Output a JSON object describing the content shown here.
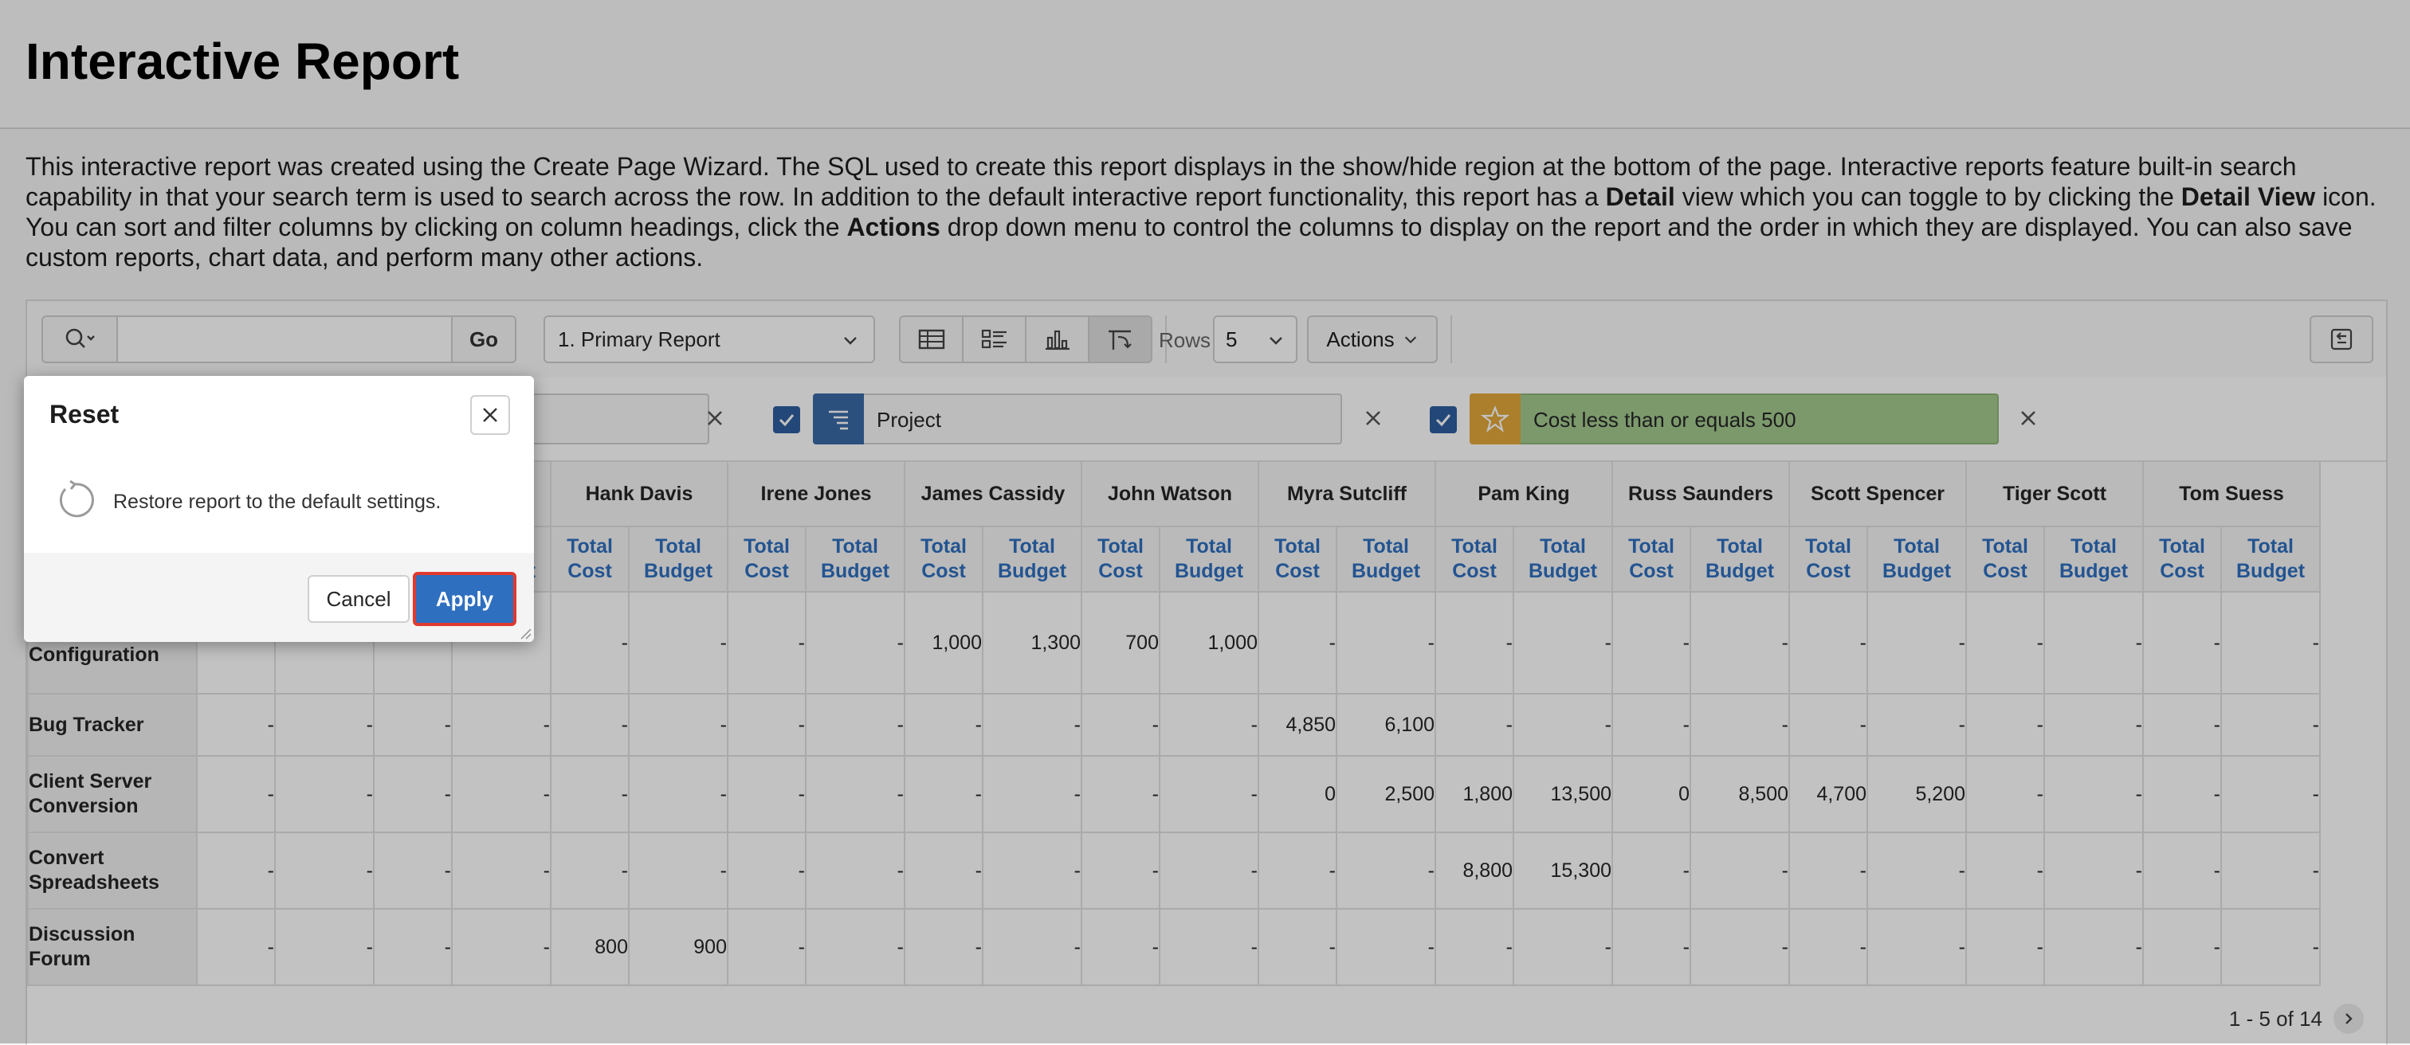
{
  "page": {
    "title": "Interactive Report",
    "description": [
      {
        "text": "This interactive report was created using the Create Page Wizard. The SQL used to create this report displays in the show/hide region at the bottom of the page. Interactive reports feature built-in search capability in that your search term is used to search across the row. In addition to the default interactive report functionality, this report has a ",
        "bold": false
      },
      {
        "text": "Detail",
        "bold": true
      },
      {
        "text": " view which you can toggle to by clicking the ",
        "bold": false
      },
      {
        "text": "Detail View",
        "bold": true
      },
      {
        "text": " icon. You can sort and filter columns by clicking on column headings, click the ",
        "bold": false
      },
      {
        "text": "Actions",
        "bold": true
      },
      {
        "text": " drop down menu to control the columns to display on the report and the order in which they are displayed. You can also save custom reports, chart data, and perform many other actions.",
        "bold": false
      }
    ]
  },
  "toolbar": {
    "search_icon": "search-icon",
    "search_value": "",
    "go_label": "Go",
    "report_select": "1. Primary Report",
    "views": [
      "grid-view-icon",
      "detail-view-icon",
      "chart-view-icon",
      "pivot-view-icon"
    ],
    "active_view": "pivot-view-icon",
    "rows_label": "Rows",
    "rows_value": "5",
    "actions_label": "Actions",
    "reset_icon": "reset-icon"
  },
  "filters": [
    {
      "checked": true,
      "icon": "pivot-icon",
      "label": "Project",
      "type": "pivot"
    },
    {
      "checked": true,
      "icon": "star-icon",
      "label": "Cost less than or equals 500",
      "type": "highlight",
      "color": "#a4c98f"
    }
  ],
  "table": {
    "pivot_columns": [
      "",
      "",
      "Hank Davis",
      "Irene Jones",
      "James Cassidy",
      "John Watson",
      "Myra Sutcliff",
      "Pam King",
      "Russ Saunders",
      "Scott Spencer",
      "Tiger Scott",
      "Tom Suess"
    ],
    "sub_columns": [
      "Total Cost",
      "Total Budget"
    ],
    "rows": [
      {
        "label": "Express Configuration",
        "values": [
          "",
          "",
          "",
          "",
          "-",
          "-",
          "-",
          "-",
          "1,000",
          "1,300",
          "700",
          "1,000",
          "-",
          "-",
          "-",
          "-",
          "-",
          "-",
          "-",
          "-",
          "-",
          "-",
          "-",
          "-"
        ]
      },
      {
        "label": "Bug Tracker",
        "values": [
          "-",
          "-",
          "-",
          "-",
          "-",
          "-",
          "-",
          "-",
          "-",
          "-",
          "-",
          "-",
          "4,850",
          "6,100",
          "-",
          "-",
          "-",
          "-",
          "-",
          "-",
          "-",
          "-",
          "-",
          "-"
        ]
      },
      {
        "label": "Client Server Conversion",
        "values": [
          "-",
          "-",
          "-",
          "-",
          "-",
          "-",
          "-",
          "-",
          "-",
          "-",
          "-",
          "-",
          "0",
          "2,500",
          "1,800",
          "13,500",
          "0",
          "8,500",
          "4,700",
          "5,200",
          "-",
          "-",
          "-",
          "-"
        ]
      },
      {
        "label": "Convert Spreadsheets",
        "values": [
          "-",
          "-",
          "-",
          "-",
          "-",
          "-",
          "-",
          "-",
          "-",
          "-",
          "-",
          "-",
          "-",
          "-",
          "8,800",
          "15,300",
          "-",
          "-",
          "-",
          "-",
          "-",
          "-",
          "-",
          "-"
        ]
      },
      {
        "label": "Discussion Forum",
        "values": [
          "-",
          "-",
          "-",
          "-",
          "800",
          "900",
          "-",
          "-",
          "-",
          "-",
          "-",
          "-",
          "-",
          "-",
          "-",
          "-",
          "-",
          "-",
          "-",
          "-",
          "-",
          "-",
          "-",
          "-"
        ]
      }
    ]
  },
  "pagination": {
    "text": "1 - 5 of 14"
  },
  "dialog": {
    "title": "Reset",
    "message": "Restore report to the default settings.",
    "icon": "undo-icon",
    "cancel_label": "Cancel",
    "apply_label": "Apply"
  }
}
